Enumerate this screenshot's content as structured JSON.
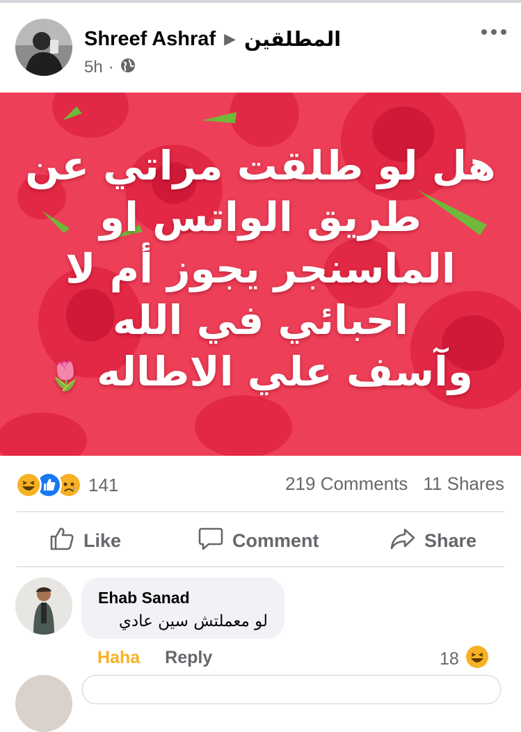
{
  "post": {
    "author": "Shreef Ashraf",
    "group": "المطلقين",
    "time": "5h",
    "privacy_icon": "globe-icon",
    "more_icon": "more-horizontal-icon"
  },
  "image": {
    "lines": [
      "هل لو طلقت مراتي عن",
      "طريق الواتس او",
      "الماسنجر يجوز أم لا",
      "احبائي في الله",
      "وآسف علي الاطاله"
    ],
    "background_color": "#ee3f58",
    "flower_emoji": "🌷"
  },
  "stats": {
    "reaction_icons": [
      "haha-icon",
      "like-icon",
      "sad-icon"
    ],
    "reaction_count": "141",
    "comments": "219 Comments",
    "shares": "11 Shares"
  },
  "actions": {
    "like": "Like",
    "comment": "Comment",
    "share": "Share"
  },
  "comment": {
    "author": "Ehab Sanad",
    "text": "لو معملتش سين عادي",
    "haha_label": "Haha",
    "reply_label": "Reply",
    "reaction_count": "18",
    "reaction_icon": "haha-icon"
  },
  "colors": {
    "haha": "#f7b125",
    "like_blue": "#1877f2",
    "muted": "#65676b"
  }
}
